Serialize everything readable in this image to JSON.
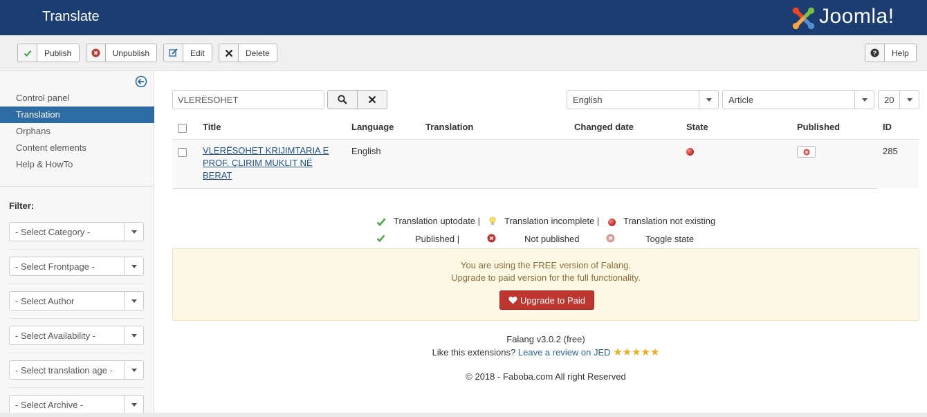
{
  "header": {
    "title": "Translate",
    "logo_text": "Joomla!",
    "logo_colors": [
      "#7ac143",
      "#f9a541",
      "#f44321",
      "#5091cd"
    ]
  },
  "toolbar": {
    "publish": "Publish",
    "unpublish": "Unpublish",
    "edit": "Edit",
    "delete": "Delete",
    "help": "Help"
  },
  "sidebar": {
    "items": [
      "Control panel",
      "Translation",
      "Orphans",
      "Content elements",
      "Help & HowTo"
    ],
    "active": "Translation",
    "filter_label": "Filter:",
    "filters": [
      "- Select Category -",
      "- Select Frontpage -",
      "- Select Author",
      "- Select Availability -",
      "- Select translation age -",
      "- Select Archive -"
    ]
  },
  "search": {
    "value": "VLERËSOHET"
  },
  "dropdowns": {
    "language": "English",
    "content_type": "Article",
    "limit": "20"
  },
  "table": {
    "columns": [
      "Title",
      "Language",
      "Translation",
      "Changed date",
      "State",
      "Published",
      "ID"
    ],
    "rows": [
      {
        "title": "VLERËSOHET KRIJIMTARIA E PROF. ÇLIRIM MUKLIT NË BERAT",
        "language": "English",
        "translation": "",
        "changed_date": "",
        "state": "not-existing",
        "published": "unpublished",
        "id": "285"
      }
    ]
  },
  "legend": {
    "uptodate": "Translation uptodate |",
    "incomplete": "Translation incomplete |",
    "not_existing": "Translation not existing",
    "published": "Published |",
    "not_published": "Not published",
    "toggle": "Toggle state"
  },
  "alert": {
    "line1": "You are using the FREE version of Falang.",
    "line2": "Upgrade to paid version for the full functionality.",
    "button": "Upgrade to Paid"
  },
  "footer": {
    "version": "Falang v3.0.2 (free)",
    "like_text": "Like this extensions?",
    "review_link": "Leave a review on JED",
    "stars": "★★★★★",
    "copyright": "© 2018 - Faboba.com All right Reserved"
  },
  "colors": {
    "header_bg": "#1c3d72",
    "active_nav": "#2d6ca2",
    "upgrade_btn": "#bd362f",
    "alert_bg": "#fcf8e3"
  }
}
